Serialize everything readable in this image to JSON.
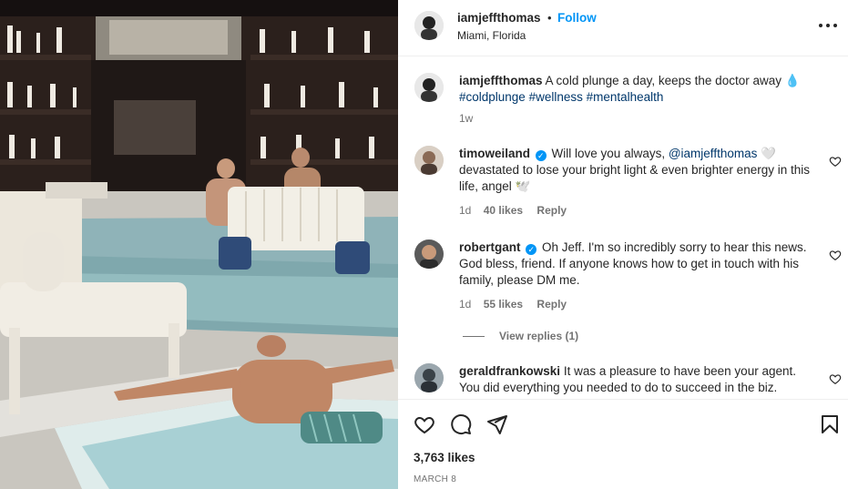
{
  "post": {
    "username": "iamjeffthomas",
    "follow_label": "Follow",
    "separator": "•",
    "location": "Miami, Florida",
    "more_icon": "more-horizontal-icon"
  },
  "caption": {
    "username": "iamjeffthomas",
    "text": "A cold plunge a day, keeps the doctor away 💧",
    "hashtags": "#coldplunge #wellness #mentalhealth",
    "time": "1w"
  },
  "comments": [
    {
      "username": "timoweiland",
      "verified": true,
      "text_before": "Will love you always, ",
      "mention": "@iamjeffthomas",
      "text_after": " 🤍 devastated to lose your bright light & even brighter energy in this life, angel 🕊️",
      "time": "1d",
      "likes": "40 likes",
      "reply": "Reply"
    },
    {
      "username": "robertgant",
      "verified": true,
      "text": "Oh Jeff. I'm so incredibly sorry to hear this news. God bless, friend. If anyone knows how to get in touch with his family, please DM me.",
      "time": "1d",
      "likes": "55 likes",
      "reply": "Reply",
      "view_replies": "View replies (1)"
    },
    {
      "username": "geraldfrankowski",
      "verified": false,
      "text": "It was a pleasure to have been your agent. You did everything you needed to do to succeed in the biz."
    }
  ],
  "footer": {
    "likes": "3,763 likes",
    "date": "MARCH 8"
  },
  "colors": {
    "accent": "#0095f6",
    "text": "#262626",
    "muted": "#737373",
    "tag": "#00376b"
  }
}
